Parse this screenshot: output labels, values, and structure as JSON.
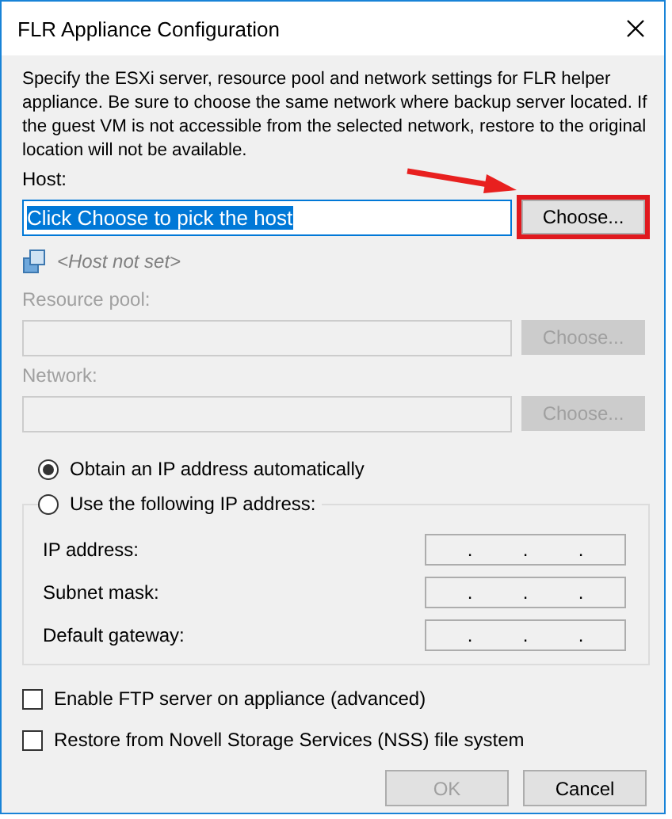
{
  "window": {
    "title": "FLR Appliance Configuration"
  },
  "description": "Specify the ESXi server, resource pool and network settings for FLR helper appliance. Be sure to choose the same network where backup server located. If the guest VM is not accessible from the selected network, restore to the original location will not be available.",
  "host": {
    "label": "Host:",
    "value": "Click Choose to pick the host",
    "value_selected": true,
    "button": "Choose...",
    "button_highlighted": true,
    "status": "<Host not set>"
  },
  "fields": [
    {
      "label": "Resource pool:",
      "disabled": true,
      "button": "Choose..."
    },
    {
      "label": "Network:",
      "disabled": true,
      "button": "Choose..."
    }
  ],
  "ip_options": [
    {
      "label": "Obtain an IP address automatically",
      "selected": true
    },
    {
      "label": "Use the following IP address:",
      "selected": false
    }
  ],
  "ip_fields": [
    {
      "label": "IP address:",
      "dots": [
        ".",
        ".",
        "."
      ]
    },
    {
      "label": "Subnet mask:",
      "dots": [
        ".",
        ".",
        "."
      ]
    },
    {
      "label": "Default gateway:",
      "dots": [
        ".",
        ".",
        "."
      ]
    }
  ],
  "checkboxes": [
    {
      "label": "Enable FTP server on appliance (advanced)",
      "checked": false
    },
    {
      "label": "Restore from Novell Storage Services (NSS) file system",
      "checked": false
    }
  ],
  "buttons": [
    {
      "label": "OK",
      "disabled": true
    },
    {
      "label": "Cancel",
      "disabled": false
    }
  ]
}
